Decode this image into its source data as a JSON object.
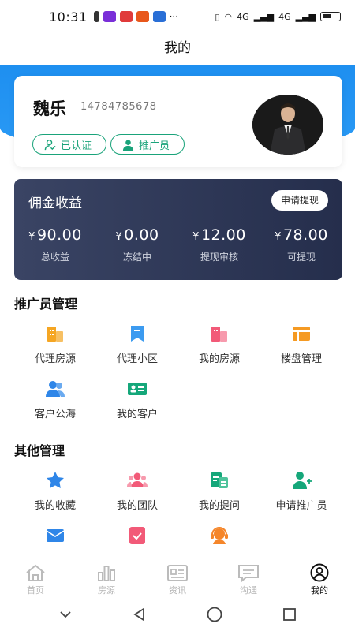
{
  "status_bar": {
    "time": "10:31",
    "network": "4G",
    "network2": "4G"
  },
  "nav": {
    "title": "我的"
  },
  "profile": {
    "name": "魏乐",
    "phone": "14784785678",
    "tag_verified": "已认证",
    "tag_promoter": "推广员"
  },
  "commission": {
    "title": "佣金收益",
    "withdraw_label": "申请提现",
    "currency": "¥",
    "stats": [
      {
        "value": "90.00",
        "label": "总收益"
      },
      {
        "value": "0.00",
        "label": "冻结中"
      },
      {
        "value": "12.00",
        "label": "提现审核"
      },
      {
        "value": "78.00",
        "label": "可提现"
      }
    ]
  },
  "promoter_section": {
    "title": "推广员管理",
    "items": [
      {
        "label": "代理房源",
        "icon": "building-icon",
        "color": "#f5a623"
      },
      {
        "label": "代理小区",
        "icon": "bookmark-icon",
        "color": "#3c9bf0"
      },
      {
        "label": "我的房源",
        "icon": "house-icon",
        "color": "#f25a78"
      },
      {
        "label": "楼盘管理",
        "icon": "property-icon",
        "color": "#f59a23"
      },
      {
        "label": "客户公海",
        "icon": "customers-icon",
        "color": "#2f86e8"
      },
      {
        "label": "我的客户",
        "icon": "contact-card-icon",
        "color": "#15a77a"
      }
    ]
  },
  "other_section": {
    "title": "其他管理",
    "items": [
      {
        "label": "我的收藏",
        "icon": "star-icon",
        "color": "#2f86e8"
      },
      {
        "label": "我的团队",
        "icon": "team-icon",
        "color": "#f25a78"
      },
      {
        "label": "我的提问",
        "icon": "question-icon",
        "color": "#15a77a"
      },
      {
        "label": "申请推广员",
        "icon": "apply-promoter-icon",
        "color": "#15a77a"
      },
      {
        "label": "",
        "icon": "mail-icon",
        "color": "#2f86e8"
      },
      {
        "label": "",
        "icon": "checklist-icon",
        "color": "#f25a78"
      },
      {
        "label": "",
        "icon": "support-icon",
        "color": "#f5862a"
      }
    ]
  },
  "tab_bar": {
    "tabs": [
      {
        "label": "首页",
        "icon": "home-icon"
      },
      {
        "label": "房源",
        "icon": "chart-icon"
      },
      {
        "label": "资讯",
        "icon": "news-icon"
      },
      {
        "label": "沟通",
        "icon": "chat-icon"
      },
      {
        "label": "我的",
        "icon": "user-icon"
      }
    ],
    "active_index": 4
  }
}
